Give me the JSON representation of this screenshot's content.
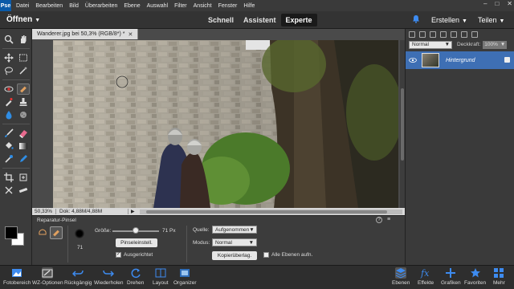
{
  "menu": {
    "logo": "Pse",
    "items": [
      "Datei",
      "Bearbeiten",
      "Bild",
      "Überarbeiten",
      "Ebene",
      "Auswahl",
      "Filter",
      "Ansicht",
      "Fenster",
      "Hilfe"
    ]
  },
  "topbar": {
    "open_label": "Öffnen",
    "modes": [
      "Schnell",
      "Assistent",
      "Experte"
    ],
    "active_mode": "Experte",
    "create_label": "Erstellen",
    "share_label": "Teilen"
  },
  "document": {
    "tab_title": "Wanderer.jpg bei 50,3% (RGB/8*) *",
    "zoom": "50,33%",
    "doc_info": "Dok: 4,88M/4,88M"
  },
  "layers_panel": {
    "blend_mode": "Normal",
    "opacity_label": "Deckkraft:",
    "opacity_value": "100%",
    "layers": [
      {
        "name": "Hintergrund"
      }
    ]
  },
  "tool_options": {
    "title": "Reparatur-Pinsel",
    "size_label": "Größe:",
    "size_value": "71 Px",
    "size_fraction": 0.5,
    "brush_size": "71",
    "brush_settings_button": "Pinseleinstell.",
    "aligned_label": "Ausgerichtet",
    "aligned_checked": true,
    "source_label": "Quelle:",
    "source_value": "Aufgenommen",
    "mode_label": "Modus:",
    "mode_value": "Normal",
    "overlay_button": "Kopierüberlag.",
    "all_layers_label": "Alle Ebenen aufn.",
    "all_layers_checked": false
  },
  "bottombar": {
    "left": [
      "Fotobereich",
      "WZ-Optionen",
      "Rückgängig",
      "Wiederholen",
      "Drehen",
      "Layout",
      "Organizer"
    ],
    "right": [
      "Ebenen",
      "Effekte",
      "Grafiken",
      "Favoriten",
      "Mehr"
    ]
  },
  "colors": {
    "accent": "#3e6fb4",
    "foreground": "#000000",
    "background": "#ffffff"
  }
}
